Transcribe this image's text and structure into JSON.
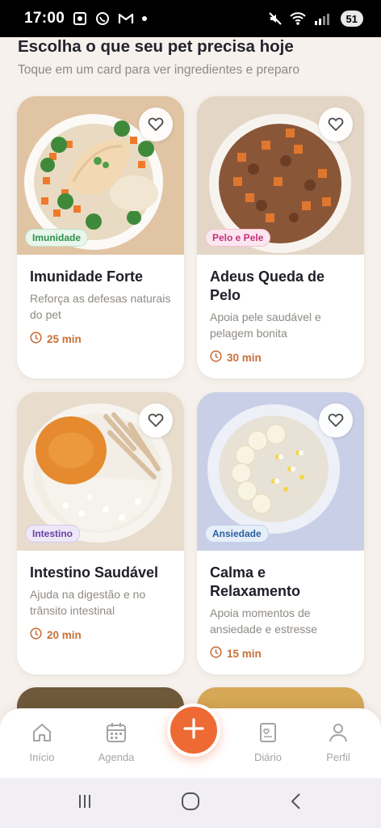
{
  "status_bar": {
    "time": "17:00",
    "battery": "51",
    "left_icons": [
      "screenshot-icon",
      "whatsapp-icon",
      "gmail-icon",
      "dot-icon"
    ],
    "right_icons": [
      "mute-icon",
      "wifi-icon",
      "signal-icon"
    ]
  },
  "header": {
    "title": "Escolha o que seu pet precisa hoje",
    "subtitle": "Toque em um card para ver ingredientes e preparo"
  },
  "cards": [
    {
      "tag": "Imunidade",
      "tag_color": "#2f8f4a",
      "tag_bg": "#e9f6ec",
      "title": "Imunidade Forte",
      "description": "Reforça as defesas naturais do pet",
      "time": "25 min",
      "image": "chicken-broccoli-carrot-rice-bowl"
    },
    {
      "tag": "Pelo e Pele",
      "tag_color": "#c2317c",
      "tag_bg": "#fde6f0",
      "title": "Adeus Queda de Pelo",
      "description": "Apoia pele saudável e pelagem bonita",
      "time": "30 min",
      "image": "beef-sweet-potato-bowl"
    },
    {
      "tag": "Intestino",
      "tag_color": "#6a3fa3",
      "tag_bg": "#eee7f8",
      "title": "Intestino Saudável",
      "description": "Ajuda na digestão e no trânsito intestinal",
      "time": "20 min",
      "image": "pumpkin-chicken-rice-bowl"
    },
    {
      "tag": "Ansiedade",
      "tag_color": "#2b5f9e",
      "tag_bg": "#e6eff9",
      "title": "Calma e Relaxamento",
      "description": "Apoia momentos de ansiedade e estresse",
      "time": "15 min",
      "image": "oats-banana-chamomile-bowl"
    }
  ],
  "bottom_nav": {
    "items": [
      {
        "label": "Início",
        "icon": "home-icon"
      },
      {
        "label": "Agenda",
        "icon": "calendar-icon"
      },
      {
        "label": "Diário",
        "icon": "journal-icon"
      },
      {
        "label": "Perfil",
        "icon": "profile-icon"
      }
    ],
    "fab_icon": "plus-icon",
    "accent": "#ee6a35"
  },
  "system_nav": [
    "recents-icon",
    "home-circle-icon",
    "back-icon"
  ]
}
